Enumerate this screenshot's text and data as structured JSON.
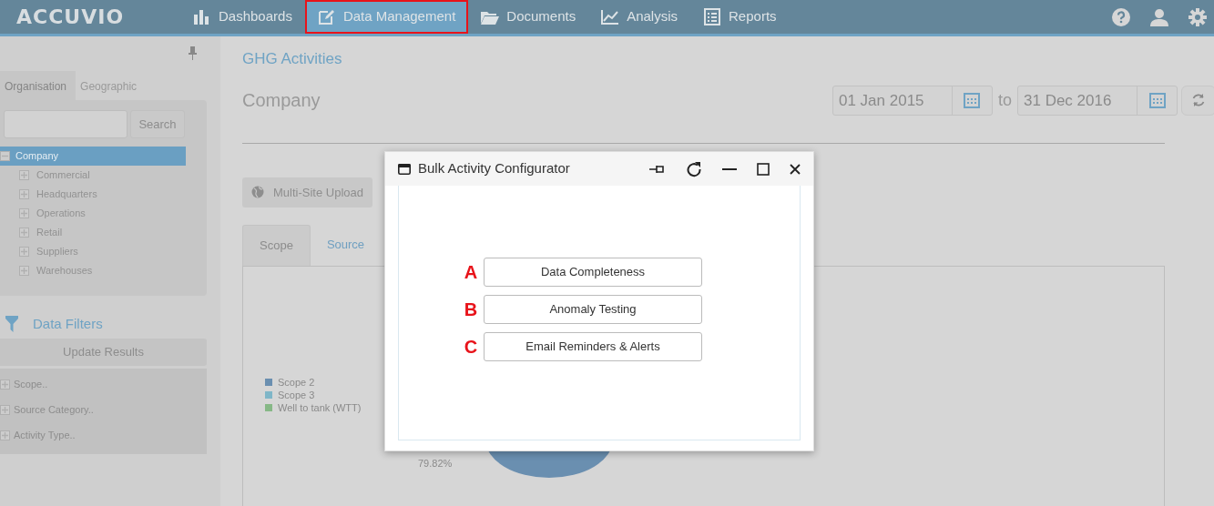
{
  "brand": {
    "logo": "ACCUVIO"
  },
  "nav": [
    {
      "label": "Dashboards",
      "selected": false
    },
    {
      "label": "Data Management",
      "selected": true
    },
    {
      "label": "Documents",
      "selected": false
    },
    {
      "label": "Analysis",
      "selected": false
    },
    {
      "label": "Reports",
      "selected": false
    }
  ],
  "sidebar": {
    "tabs": [
      {
        "label": "Organisation",
        "selected": true
      },
      {
        "label": "Geographic",
        "selected": false
      }
    ],
    "search_button": "Search",
    "tree": [
      {
        "label": "Company",
        "selected": true,
        "expanded": true,
        "children": [
          {
            "label": "Commercial",
            "selected": false,
            "expanded": false
          },
          {
            "label": "Headquarters",
            "selected": false,
            "expanded": false
          },
          {
            "label": "Operations",
            "selected": false,
            "expanded": false
          },
          {
            "label": "Retail",
            "selected": false,
            "expanded": false
          },
          {
            "label": "Suppliers",
            "selected": false,
            "expanded": false
          },
          {
            "label": "Warehouses",
            "selected": false,
            "expanded": false
          }
        ]
      }
    ],
    "filters_title": "Data Filters",
    "update_button": "Update Results",
    "filters": [
      {
        "label": "Scope..",
        "expanded": false
      },
      {
        "label": "Source Category..",
        "expanded": false
      },
      {
        "label": "Activity Type..",
        "expanded": false
      }
    ]
  },
  "main": {
    "breadcrumb": "GHG Activities",
    "title": "Company",
    "date_from": "01 Jan 2015",
    "to_label": "to",
    "date_to": "31 Dec 2016",
    "upload_button": "Multi-Site Upload",
    "tabs": [
      {
        "label": "Scope",
        "selected": true
      },
      {
        "label": "Source",
        "selected": false
      }
    ],
    "legend": [
      {
        "label": "Scope 2",
        "color": "#6a8fb0"
      },
      {
        "label": "Scope 3",
        "color": "#7fb6c8"
      },
      {
        "label": "Well to tank (WTT)",
        "color": "#86b886"
      }
    ],
    "pie_label": "79.82%"
  },
  "dialog": {
    "title": "Bulk Activity Configurator",
    "options": [
      {
        "marker": "A",
        "label": "Data Completeness"
      },
      {
        "marker": "B",
        "label": "Anomaly Testing"
      },
      {
        "marker": "C",
        "label": "Email Reminders & Alerts"
      }
    ]
  }
}
